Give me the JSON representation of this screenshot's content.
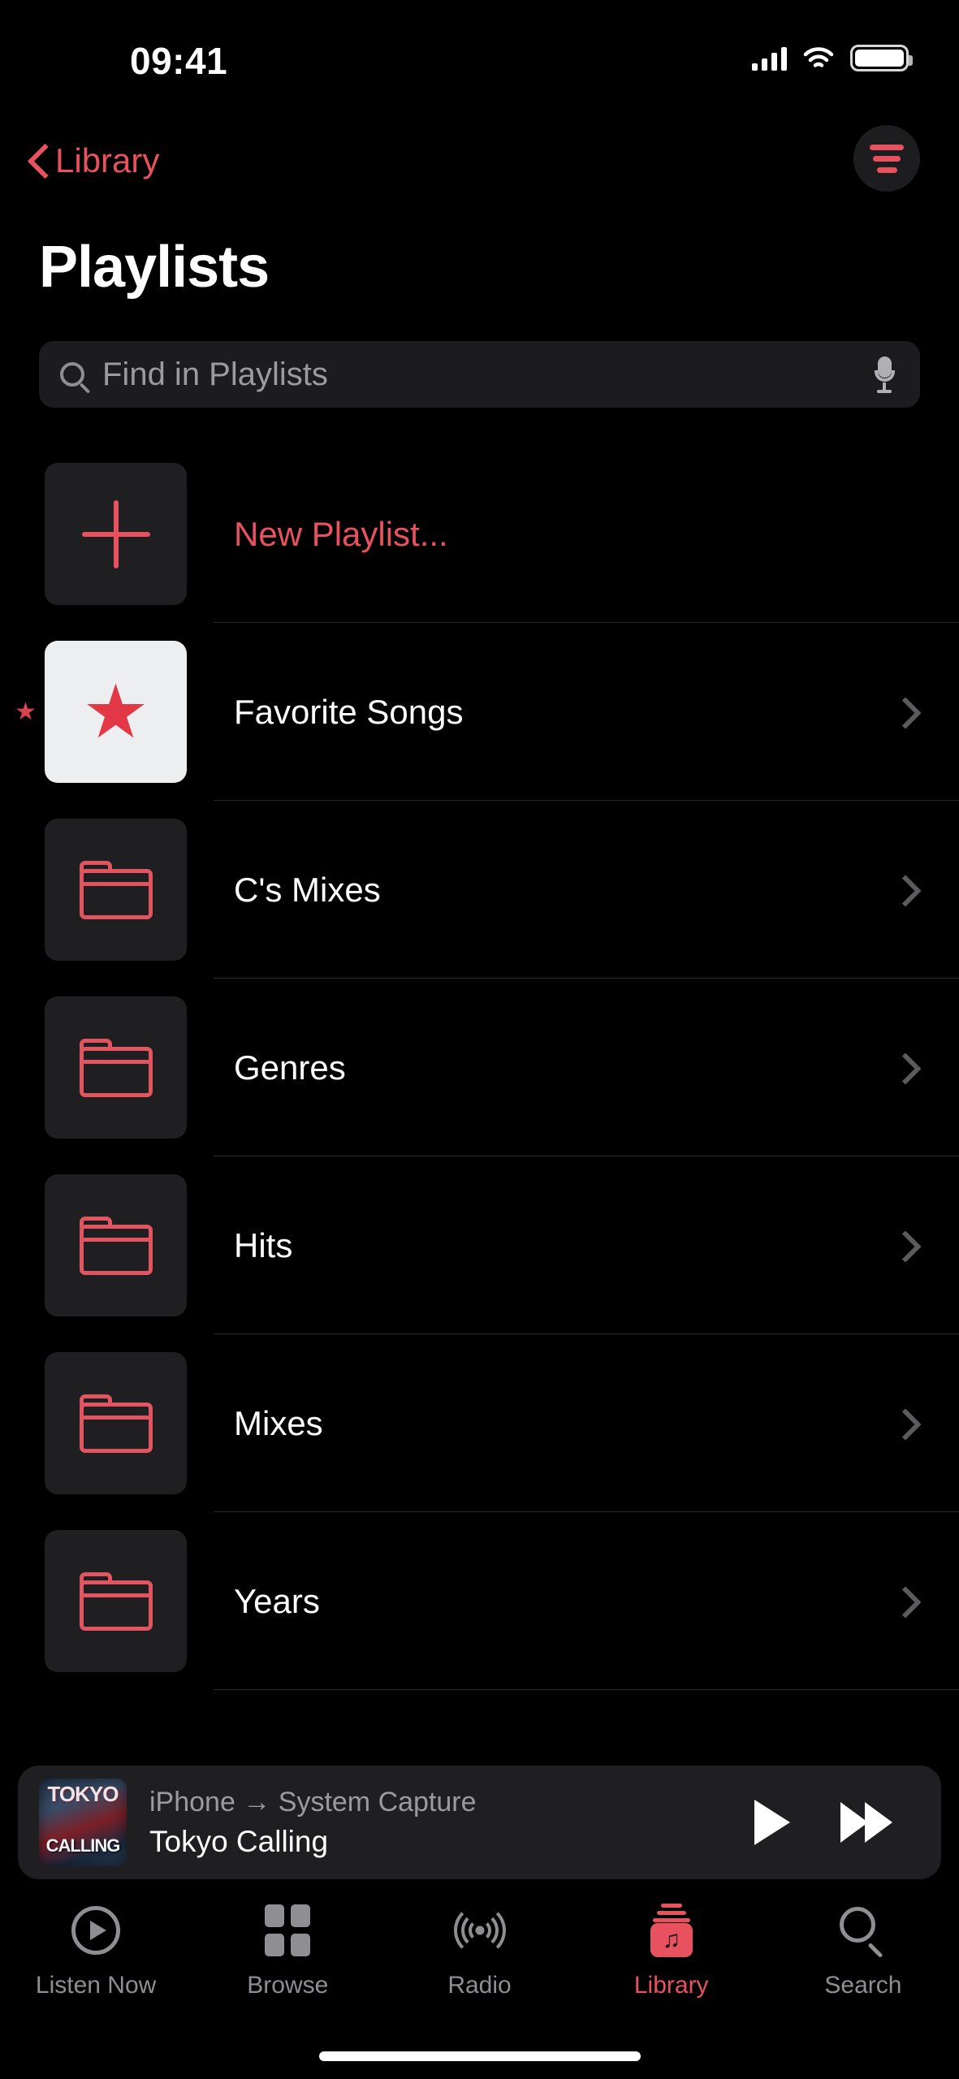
{
  "status_bar": {
    "time": "09:41",
    "cellular_icon": "cellular-bars-icon",
    "wifi_icon": "wifi-icon",
    "battery_icon": "battery-full-icon"
  },
  "nav": {
    "back_label": "Library",
    "back_icon": "chevron-left-icon",
    "sort_icon": "sort-filter-lines-icon"
  },
  "page_title": "Playlists",
  "search": {
    "placeholder": "Find in Playlists",
    "search_icon": "search-icon",
    "mic_icon": "microphone-icon"
  },
  "rows": [
    {
      "label": "New Playlist...",
      "icon": "plus-icon",
      "accent": true,
      "tile": "dark",
      "chevron": false,
      "favorite_mark": false
    },
    {
      "label": "Favorite Songs",
      "icon": "star-icon",
      "accent": false,
      "tile": "white",
      "chevron": true,
      "favorite_mark": true
    },
    {
      "label": "C's Mixes",
      "icon": "folder-icon",
      "accent": false,
      "tile": "dark",
      "chevron": true,
      "favorite_mark": false
    },
    {
      "label": "Genres",
      "icon": "folder-icon",
      "accent": false,
      "tile": "dark",
      "chevron": true,
      "favorite_mark": false
    },
    {
      "label": "Hits",
      "icon": "folder-icon",
      "accent": false,
      "tile": "dark",
      "chevron": true,
      "favorite_mark": false
    },
    {
      "label": "Mixes",
      "icon": "folder-icon",
      "accent": false,
      "tile": "dark",
      "chevron": true,
      "favorite_mark": false
    },
    {
      "label": "Years",
      "icon": "folder-icon",
      "accent": false,
      "tile": "dark",
      "chevron": true,
      "favorite_mark": false
    }
  ],
  "favorite_marker": "★",
  "now_playing": {
    "route": "iPhone → System Capture",
    "title": "Tokyo Calling",
    "artwork_top_text": "TOKYO",
    "artwork_bottom_text": "CALLING",
    "play_icon": "play-icon",
    "forward_icon": "fast-forward-icon"
  },
  "tabs": [
    {
      "label": "Listen Now",
      "icon": "play-circle-icon",
      "active": false
    },
    {
      "label": "Browse",
      "icon": "grid-squares-icon",
      "active": false
    },
    {
      "label": "Radio",
      "icon": "radio-waves-icon",
      "active": false
    },
    {
      "label": "Library",
      "icon": "music-library-icon",
      "active": true
    },
    {
      "label": "Search",
      "icon": "search-icon",
      "active": false
    }
  ],
  "colors": {
    "accent": "#e8515e",
    "background": "#000000",
    "tile": "#1f1f21",
    "secondary_text": "#8e8e93"
  }
}
